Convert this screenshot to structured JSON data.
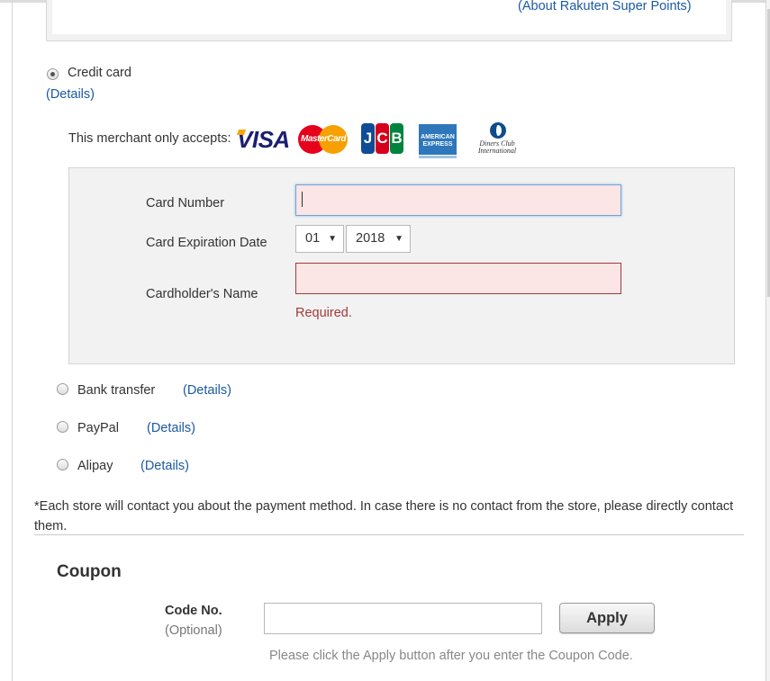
{
  "points": {
    "about_link": "(About Rakuten Super Points)"
  },
  "payment": {
    "credit_card": {
      "label": "Credit card",
      "details": "(Details)",
      "accepts_text": "This merchant only accepts:",
      "logos": {
        "visa": "VISA",
        "mastercard": "MasterCard",
        "jcb": [
          "J",
          "C",
          "B"
        ],
        "amex": "AMERICAN EXPRESS",
        "diners": "Diners Club International"
      },
      "card_number_label": "Card Number",
      "card_number_value": "",
      "expiration_label": "Card Expiration Date",
      "expiration_month": "01",
      "expiration_year": "2018",
      "cardholder_label": "Cardholder's Name",
      "cardholder_value": "",
      "required_error": "Required."
    },
    "options": [
      {
        "label": "Bank transfer",
        "details": "(Details)"
      },
      {
        "label": "PayPal",
        "details": "(Details)"
      },
      {
        "label": "Alipay",
        "details": "(Details)"
      }
    ],
    "note": "*Each store will contact you about the payment method. In case there is no contact from the store, please directly contact them."
  },
  "coupon": {
    "title": "Coupon",
    "code_label": "Code No.",
    "optional": "(Optional)",
    "input_value": "",
    "apply_label": "Apply",
    "hint": "Please click the Apply button after you enter the Coupon Code."
  },
  "colors": {
    "link": "#1a5aa0",
    "error": "#a33a3a",
    "error_bg": "#fbe5e5",
    "panel_bg": "#f2f2f2"
  },
  "icons": [
    "radio-selected-icon",
    "radio-unselected-icon",
    "dropdown-arrow-icon",
    "visa-logo",
    "mastercard-logo",
    "jcb-logo",
    "amex-logo",
    "diners-club-logo"
  ]
}
